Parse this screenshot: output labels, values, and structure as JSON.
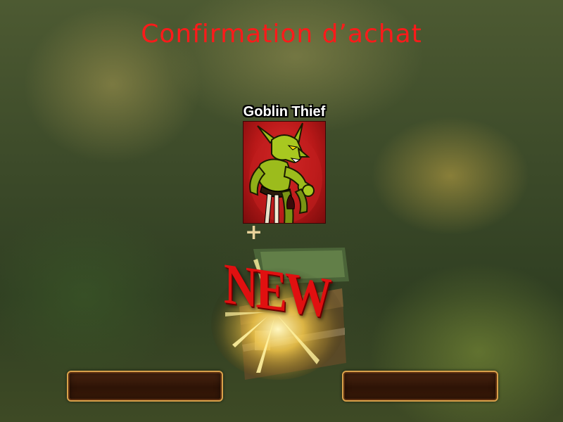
{
  "dialog": {
    "title": "Confirmation d’achat",
    "title_color": "#ff1a1a"
  },
  "item": {
    "name": "Goblin Thief",
    "card_background": "#cc2020",
    "icon": "goblin-thief-portrait"
  },
  "bonus": {
    "plus_symbol": "+",
    "badge_text": "NEW",
    "badge_color": "#e01010",
    "icon": "treasure-chest-icon"
  },
  "buttons": {
    "left_label": "",
    "right_label": "",
    "border_color": "#d9a14a"
  }
}
